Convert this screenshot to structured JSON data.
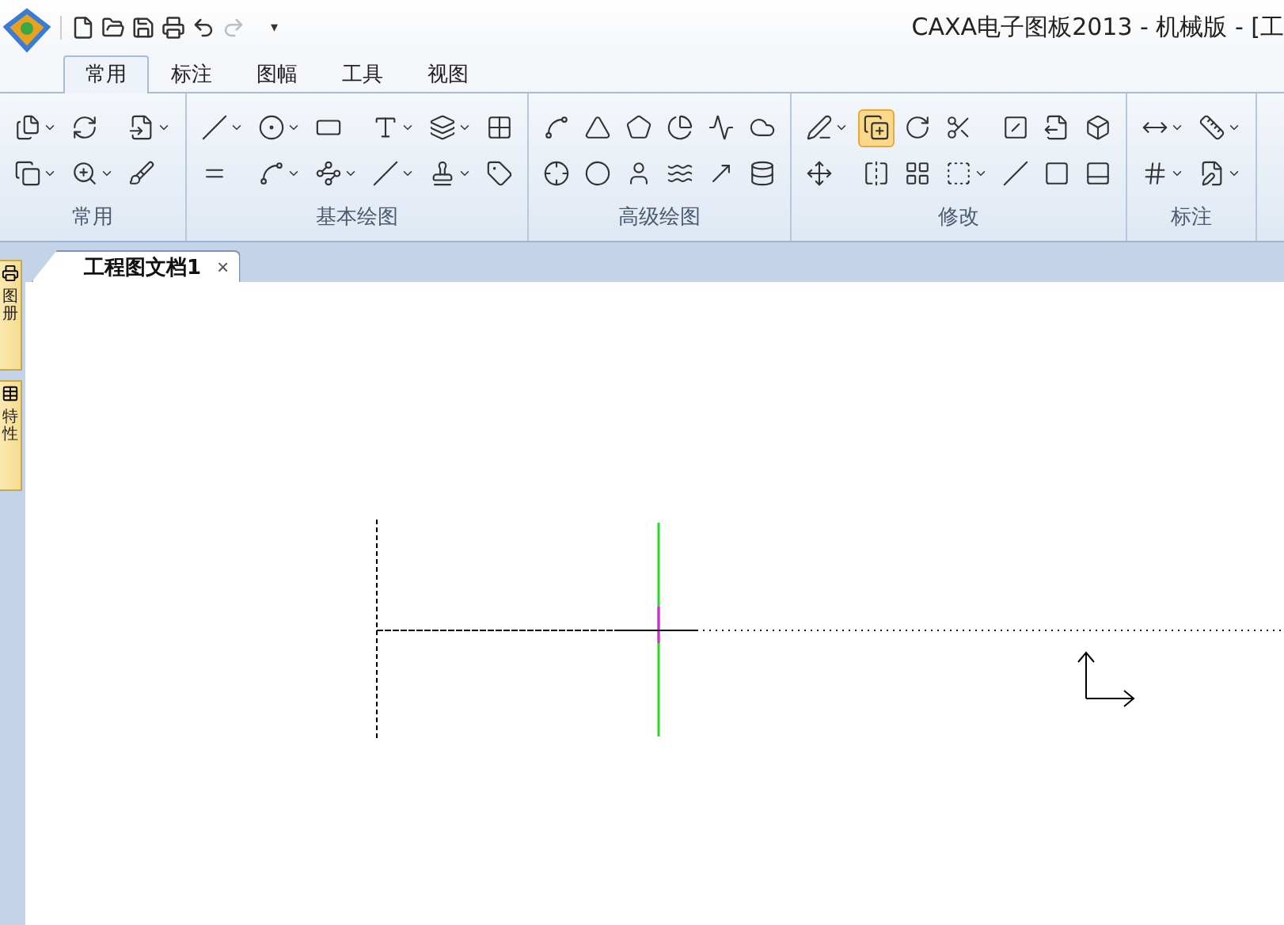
{
  "window": {
    "title": "CAXA电子图板2013 - 机械版 - [工"
  },
  "quick_access": {
    "more": "▾"
  },
  "tabs": [
    {
      "label": "常用",
      "selected": true
    },
    {
      "label": "标注",
      "selected": false
    },
    {
      "label": "图幅",
      "selected": false
    },
    {
      "label": "工具",
      "selected": false
    },
    {
      "label": "视图",
      "selected": false
    }
  ],
  "ribbon_groups": [
    {
      "label": "常用",
      "tools": [
        {
          "selected": false,
          "dropdown": true
        },
        {
          "selected": false,
          "dropdown": true
        },
        {
          "selected": false,
          "dropdown": false
        },
        {
          "selected": false,
          "dropdown": true
        },
        {
          "selected": false,
          "dropdown": true
        },
        {
          "selected": false,
          "dropdown": false
        }
      ]
    },
    {
      "label": "基本绘图",
      "tools": [
        {
          "selected": false,
          "dropdown": true
        },
        {
          "selected": false,
          "dropdown": false
        },
        {
          "selected": false,
          "dropdown": true
        },
        {
          "selected": false,
          "dropdown": true
        },
        {
          "selected": false,
          "dropdown": false
        },
        {
          "selected": false,
          "dropdown": true
        },
        {
          "selected": false,
          "dropdown": true
        },
        {
          "selected": false,
          "dropdown": true
        },
        {
          "selected": false,
          "dropdown": true
        },
        {
          "selected": false,
          "dropdown": true
        },
        {
          "selected": false,
          "dropdown": false
        },
        {
          "selected": false,
          "dropdown": false
        }
      ]
    },
    {
      "label": "高级绘图",
      "tools": [
        {
          "selected": false,
          "dropdown": false
        },
        {
          "selected": false,
          "dropdown": false
        },
        {
          "selected": false,
          "dropdown": false
        },
        {
          "selected": false,
          "dropdown": false
        },
        {
          "selected": false,
          "dropdown": false
        },
        {
          "selected": false,
          "dropdown": false
        },
        {
          "selected": false,
          "dropdown": false
        },
        {
          "selected": false,
          "dropdown": false
        },
        {
          "selected": false,
          "dropdown": false
        },
        {
          "selected": false,
          "dropdown": false
        },
        {
          "selected": false,
          "dropdown": false
        },
        {
          "selected": false,
          "dropdown": false
        }
      ]
    },
    {
      "label": "修改",
      "tools": [
        {
          "selected": false,
          "dropdown": true
        },
        {
          "selected": false,
          "dropdown": false
        },
        {
          "selected": true,
          "dropdown": false
        },
        {
          "selected": false,
          "dropdown": false
        },
        {
          "selected": false,
          "dropdown": false
        },
        {
          "selected": false,
          "dropdown": false
        },
        {
          "selected": false,
          "dropdown": false
        },
        {
          "selected": false,
          "dropdown": true
        },
        {
          "selected": false,
          "dropdown": false
        },
        {
          "selected": false,
          "dropdown": false
        },
        {
          "selected": false,
          "dropdown": false
        },
        {
          "selected": false,
          "dropdown": false
        },
        {
          "selected": false,
          "dropdown": false
        },
        {
          "selected": false,
          "dropdown": false
        }
      ]
    },
    {
      "label": "标注",
      "tools": [
        {
          "selected": false,
          "dropdown": true
        },
        {
          "selected": false,
          "dropdown": true
        },
        {
          "selected": false,
          "dropdown": true
        },
        {
          "selected": false,
          "dropdown": true
        }
      ]
    }
  ],
  "side_panels": [
    {
      "label": "图册"
    },
    {
      "label": "特性"
    }
  ],
  "documents": [
    {
      "title": "工程图文档1",
      "selected": true,
      "close": "×"
    }
  ]
}
